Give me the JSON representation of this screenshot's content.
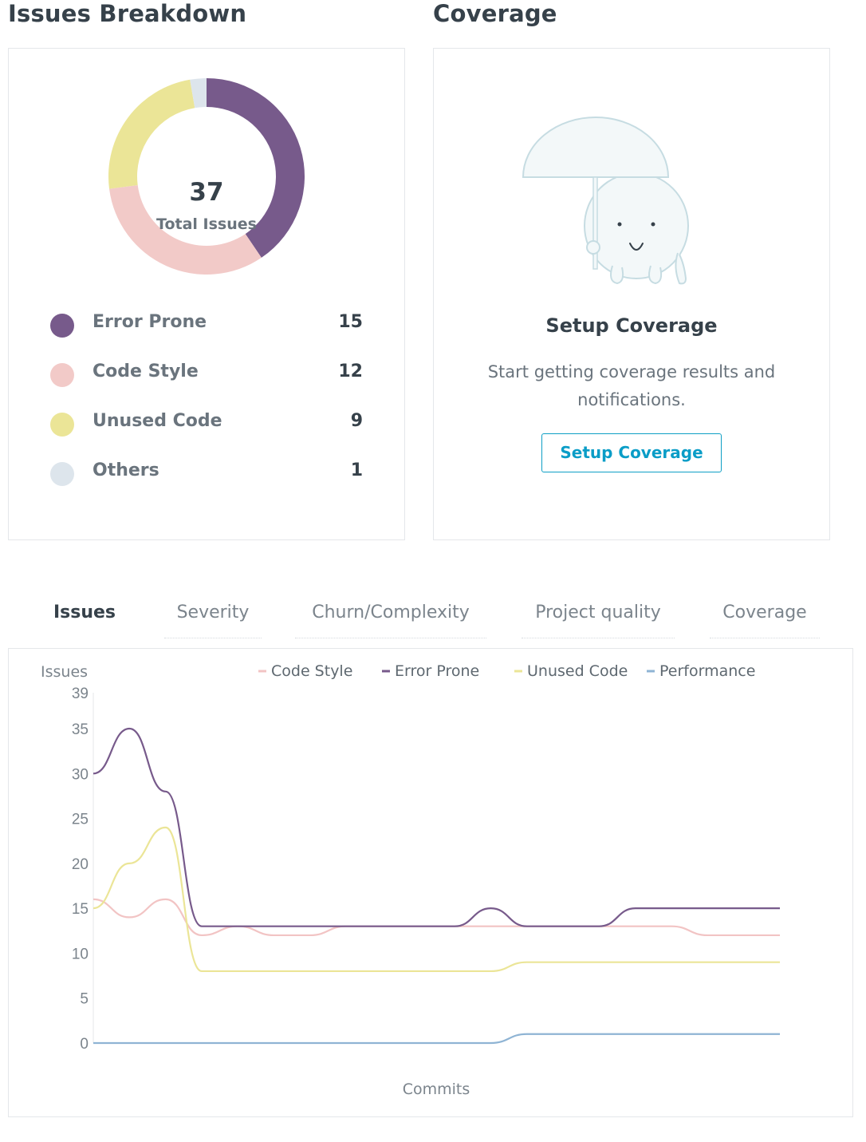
{
  "issues_breakdown": {
    "title": "Issues Breakdown",
    "total_value": "37",
    "total_label": "Total Issues",
    "categories": [
      {
        "label": "Error Prone",
        "value": 15,
        "color": "#775a8b"
      },
      {
        "label": "Code Style",
        "value": 12,
        "color": "#f2cac8"
      },
      {
        "label": "Unused Code",
        "value": 9,
        "color": "#ebe597"
      },
      {
        "label": "Others",
        "value": 1,
        "color": "#dde5ec"
      }
    ]
  },
  "coverage": {
    "title": "Coverage",
    "heading": "Setup Coverage",
    "description": "Start getting coverage results and notifications.",
    "button_label": "Setup Coverage",
    "illustration": "umbrella-character-illustration"
  },
  "tabs": [
    {
      "label": "Issues",
      "active": true
    },
    {
      "label": "Severity",
      "active": false
    },
    {
      "label": "Churn/Complexity",
      "active": false
    },
    {
      "label": "Project quality",
      "active": false
    },
    {
      "label": "Coverage",
      "active": false
    }
  ],
  "chart_data": {
    "type": "line",
    "ylabel": "Issues",
    "xlabel": "Commits",
    "ylim": [
      0,
      39
    ],
    "yticks": [
      0,
      5,
      10,
      15,
      20,
      25,
      30,
      35,
      39
    ],
    "grid": false,
    "legend_position": "top",
    "x": [
      0,
      1,
      2,
      3,
      4,
      5,
      6,
      7,
      8,
      9,
      10,
      11,
      12,
      13,
      14,
      15,
      16,
      17,
      18,
      19
    ],
    "series": [
      {
        "name": "Code Style",
        "color": "#f2c4c4",
        "values": [
          16,
          14,
          16,
          12,
          13,
          12,
          12,
          13,
          13,
          13,
          13,
          13,
          13,
          13,
          13,
          13,
          13,
          12,
          12,
          12
        ]
      },
      {
        "name": "Error Prone",
        "color": "#775a8b",
        "values": [
          30,
          35,
          28,
          13,
          13,
          13,
          13,
          13,
          13,
          13,
          13,
          15,
          13,
          13,
          13,
          15,
          15,
          15,
          15,
          15
        ]
      },
      {
        "name": "Unused Code",
        "color": "#ebe597",
        "values": [
          15,
          20,
          24,
          8,
          8,
          8,
          8,
          8,
          8,
          8,
          8,
          8,
          9,
          9,
          9,
          9,
          9,
          9,
          9,
          9
        ]
      },
      {
        "name": "Performance",
        "color": "#8fb4d4",
        "values": [
          0,
          0,
          0,
          0,
          0,
          0,
          0,
          0,
          0,
          0,
          0,
          0,
          1,
          1,
          1,
          1,
          1,
          1,
          1,
          1
        ]
      }
    ]
  }
}
